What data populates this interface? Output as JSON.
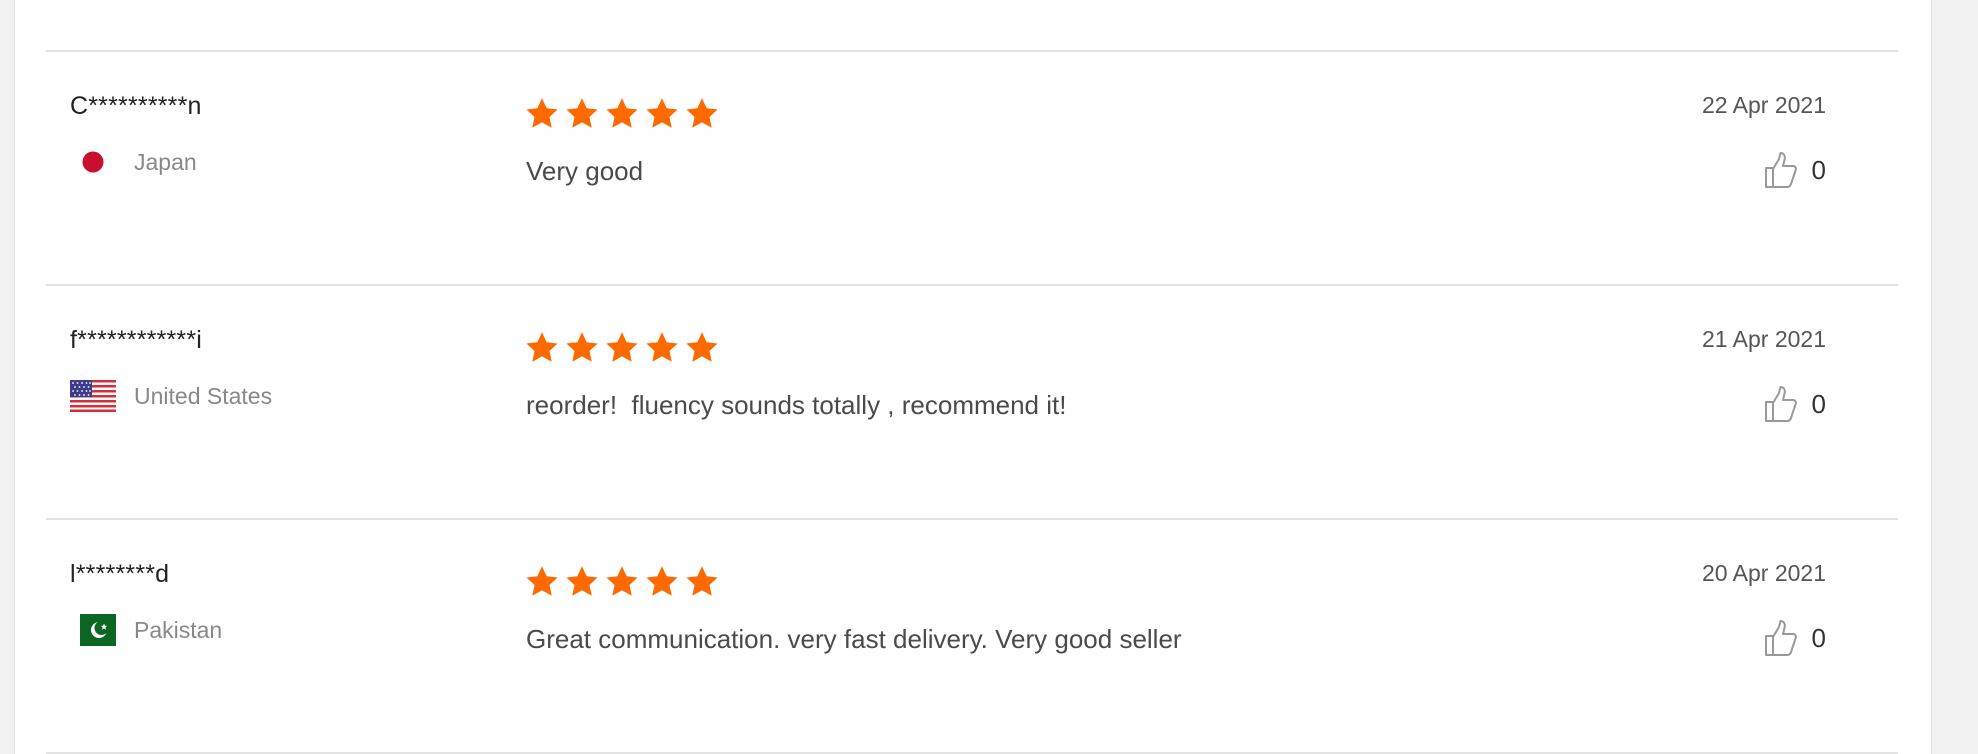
{
  "colors": {
    "star": "#ff6a00",
    "divider": "#e3e3e3"
  },
  "reviews": [
    {
      "user": "C**********n",
      "country": "Japan",
      "flag_icon": "japan-flag-icon",
      "rating": 5,
      "comment": "Very good",
      "date": "22 Apr 2021",
      "helpful_count": "0"
    },
    {
      "user": "f************i",
      "country": "United States",
      "flag_icon": "usa-flag-icon",
      "rating": 5,
      "comment": "reorder!  fluency sounds totally , recommend it!",
      "date": "21 Apr 2021",
      "helpful_count": "0"
    },
    {
      "user": "l********d",
      "country": "Pakistan",
      "flag_icon": "pakistan-flag-icon",
      "rating": 5,
      "comment": "Great communication. very fast delivery. Very good seller",
      "date": "20 Apr 2021",
      "helpful_count": "0"
    }
  ]
}
